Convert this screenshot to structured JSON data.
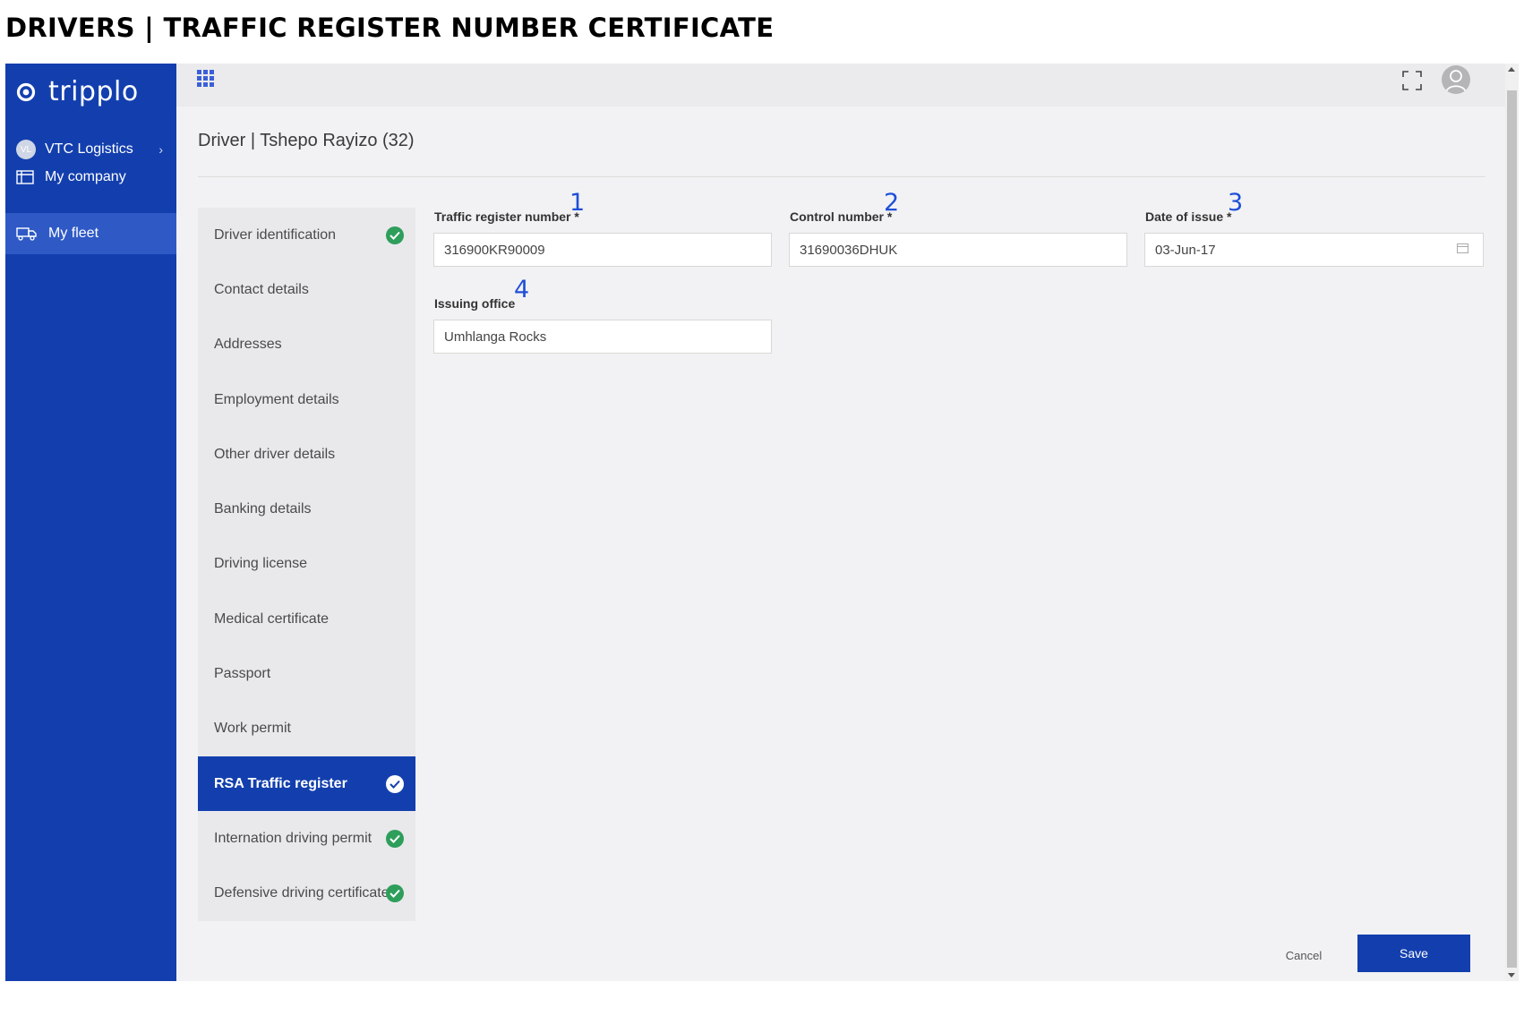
{
  "doc_title": "DRIVERS | TRAFFIC REGISTER NUMBER CERTIFICATE",
  "brand": {
    "name": "tripplo"
  },
  "colors": {
    "sidebar": "#133fae",
    "sidebar_active": "#2f5ac6",
    "success": "#2e9e5b",
    "primary_button": "#133fae",
    "annotation": "#1f4fd8"
  },
  "sidebar": {
    "company": {
      "initials": "VL",
      "name": "VTC Logistics"
    },
    "items": [
      {
        "label": "My company",
        "icon": "building-icon"
      },
      {
        "label": "My fleet",
        "icon": "truck-icon",
        "active": true
      }
    ]
  },
  "page": {
    "title": "Driver | Tshepo Rayizo (32)"
  },
  "steps": [
    {
      "label": "Driver identification",
      "complete": true
    },
    {
      "label": "Contact details",
      "complete": false
    },
    {
      "label": "Addresses",
      "complete": false
    },
    {
      "label": "Employment details",
      "complete": false
    },
    {
      "label": "Other driver details",
      "complete": false
    },
    {
      "label": "Banking details",
      "complete": false
    },
    {
      "label": "Driving license",
      "complete": false
    },
    {
      "label": "Medical certificate",
      "complete": false
    },
    {
      "label": "Passport",
      "complete": false
    },
    {
      "label": "Work permit",
      "complete": false
    },
    {
      "label": "RSA Traffic register",
      "complete": true,
      "active": true
    },
    {
      "label": "Internation driving permit",
      "complete": true
    },
    {
      "label": "Defensive driving certificate",
      "complete": true
    }
  ],
  "form": {
    "traffic_register_number": {
      "label": "Traffic register number *",
      "value": "316900KR90009",
      "annotation": "1"
    },
    "control_number": {
      "label": "Control number *",
      "value": "31690036DHUK",
      "annotation": "2"
    },
    "date_of_issue": {
      "label": "Date of issue *",
      "value": "03-Jun-17",
      "annotation": "3"
    },
    "issuing_office": {
      "label": "Issuing office",
      "value": "Umhlanga Rocks",
      "annotation": "4"
    }
  },
  "actions": {
    "cancel": "Cancel",
    "save": "Save"
  }
}
